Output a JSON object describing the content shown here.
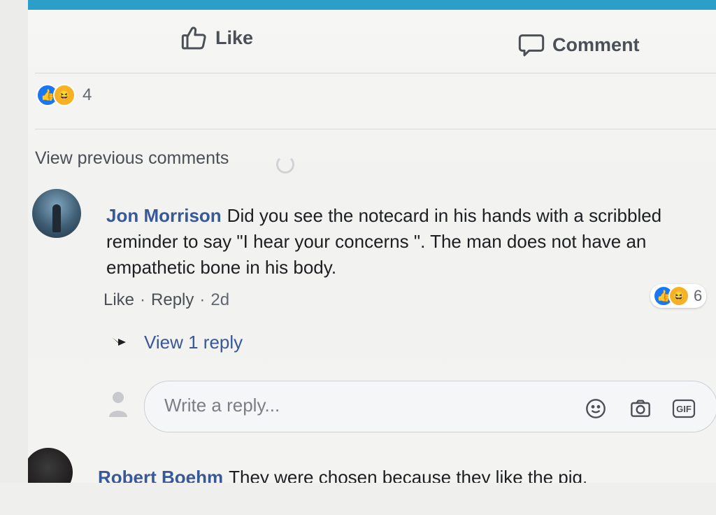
{
  "actions": {
    "like_label": "Like",
    "comment_label": "Comment"
  },
  "post_reactions": {
    "icons": [
      "like-icon",
      "haha-icon"
    ],
    "count": "4"
  },
  "view_previous": "View previous comments",
  "comments": [
    {
      "author": "Jon Morrison",
      "text": "Did you see the notecard in his hands with a scribbled reminder to say \"I hear your concerns \". The man does not have an empathetic bone in his body.",
      "like_label": "Like",
      "reply_label": "Reply",
      "separator": "·",
      "time": "2d",
      "reaction_count": "6",
      "view_replies": "View 1 reply"
    },
    {
      "author": "Robert Boehm",
      "text": "They were chosen because they like the pig."
    }
  ],
  "reply_box": {
    "placeholder": "Write a reply...",
    "icons": [
      "emoji-icon",
      "camera-icon",
      "gif-icon"
    ],
    "gif_label": "GIF"
  },
  "colors": {
    "link": "#385898",
    "like_blue": "#1877f2",
    "haha_yellow": "#f7b125",
    "top_bar": "#2aa0c8"
  }
}
